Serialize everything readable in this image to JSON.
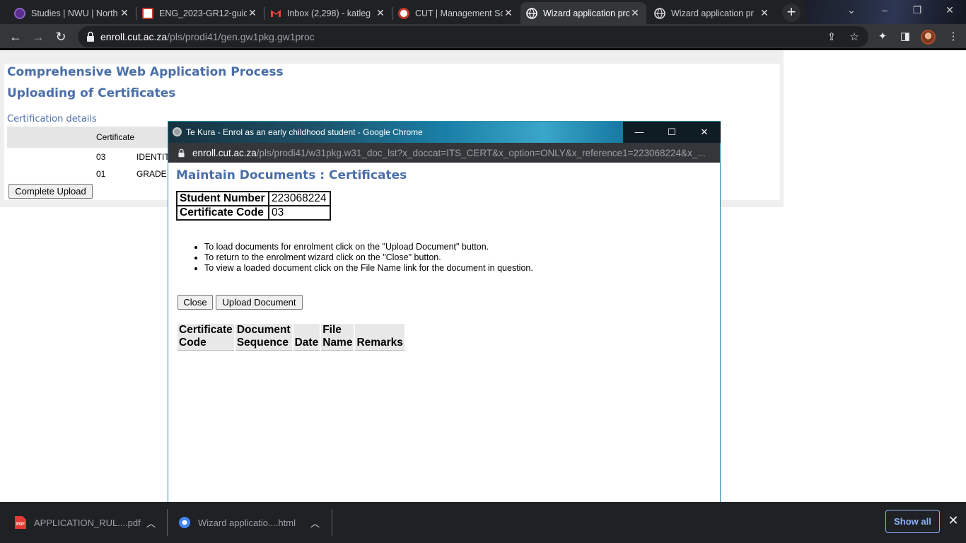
{
  "browser": {
    "tabs": [
      {
        "title": "Studies | NWU | North",
        "icon": "nwu-icon",
        "active": false
      },
      {
        "title": "ENG_2023-GR12-guid",
        "icon": "doc-icon",
        "active": false
      },
      {
        "title": "Inbox (2,298) - katleg",
        "icon": "gmail-icon",
        "active": false
      },
      {
        "title": "CUT | Management Sc",
        "icon": "cut-icon",
        "active": false
      },
      {
        "title": "Wizard application pro",
        "icon": "globe-icon",
        "active": true
      },
      {
        "title": "Wizard application pr",
        "icon": "globe-icon",
        "active": false
      }
    ],
    "address": {
      "host": "enroll.cut.ac.za",
      "path": "/pls/prodi41/gen.gw1pkg.gw1proc"
    }
  },
  "page": {
    "title": "Comprehensive Web Application Process",
    "subtitle": "Uploading of Certificates",
    "section_label": "Certification details",
    "table_header": "Certificate",
    "rows": [
      {
        "code": "03",
        "name": "IDENTIT"
      },
      {
        "code": "01",
        "name": "GRADE"
      }
    ],
    "complete_button": "Complete Upload"
  },
  "popup": {
    "window_title": "Te Kura - Enrol as an early childhood student - Google Chrome",
    "address": {
      "host": "enroll.cut.ac.za",
      "path": "/pls/prodi41/w31pkg.w31_doc_lst?x_doccat=ITS_CERT&x_option=ONLY&x_reference1=223068224&x_..."
    },
    "heading": "Maintain Documents : Certificates",
    "info": [
      {
        "label": "Student Number",
        "value": "223068224"
      },
      {
        "label": "Certificate Code",
        "value": "03"
      }
    ],
    "instructions": [
      "To load documents for enrolment click on the \"Upload Document\" button.",
      "To return to the enrolment wizard click on the \"Close\" button.",
      "To view a loaded document click on the File Name link for the document in question."
    ],
    "close_button": "Close",
    "upload_button": "Upload Document",
    "doc_columns": [
      [
        "Certificate",
        "Code"
      ],
      [
        "Document",
        "Sequence"
      ],
      [
        "",
        "Date"
      ],
      [
        "File",
        "Name"
      ],
      [
        "",
        "Remarks"
      ]
    ]
  },
  "downloads": {
    "items": [
      {
        "name": "APPLICATION_RUL....pdf",
        "icon": "pdf-icon"
      },
      {
        "name": "Wizard applicatio....html",
        "icon": "chrome-icon"
      }
    ],
    "show_all": "Show all"
  }
}
